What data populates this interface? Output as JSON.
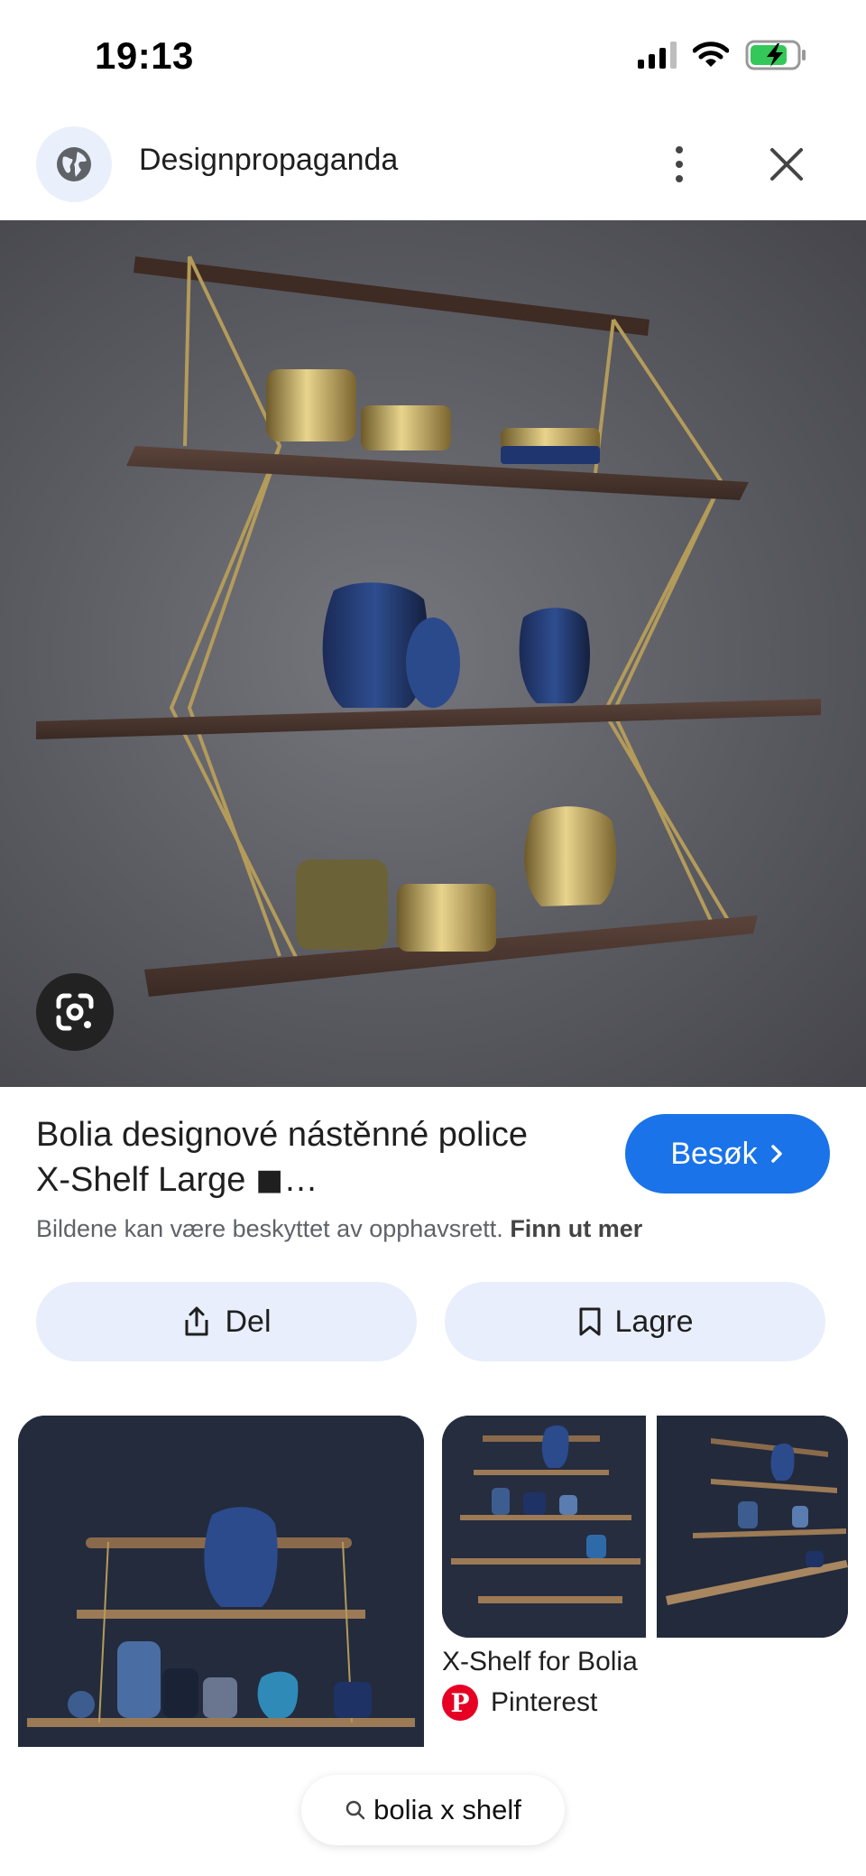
{
  "status_bar": {
    "time": "19:13",
    "icons": [
      "signal-icon",
      "wifi-icon",
      "battery-charging-icon"
    ]
  },
  "header": {
    "site_name": "Designpropaganda",
    "icons": [
      "globe-icon",
      "more-vert-icon",
      "close-icon"
    ]
  },
  "main_image": {
    "lens_icon": "google-lens-icon"
  },
  "result": {
    "title_line1": "Bolia designové nástěnné police",
    "title_line2": "X-Shelf Large ◼…",
    "visit_label": "Besøk",
    "copyright_text": "Bildene kan være beskyttet av opphavsrett.",
    "learn_more": "Finn ut mer"
  },
  "actions": {
    "share_label": "Del",
    "save_label": "Lagre"
  },
  "related": {
    "item_title": "X-Shelf for Bolia",
    "item_source": "Pinterest"
  },
  "search": {
    "query": "bolia x shelf"
  },
  "colors": {
    "accent": "#1a73e8",
    "button_bg": "#e8eefb",
    "pinterest": "#e60023"
  }
}
